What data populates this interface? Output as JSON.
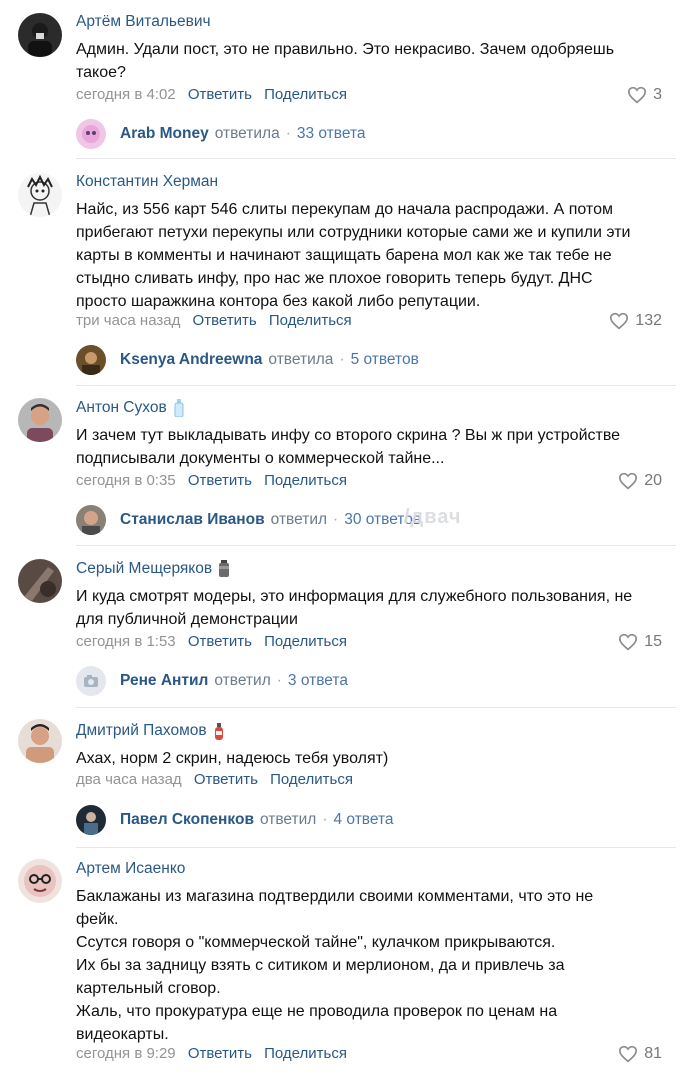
{
  "actions": {
    "reply": "Ответить",
    "share": "Поделиться"
  },
  "watermark": "/двач",
  "comments": [
    {
      "author": "Артём Витальевич",
      "text": "Админ. Удали пост, это не правильно. Это некрасиво. Зачем одобряешь\nтакое?",
      "time": "сегодня в 4:02",
      "likes": "3",
      "reply": {
        "name": "Arab Money",
        "verb": "ответила",
        "count": "33 ответа"
      }
    },
    {
      "author": "Константин Херман",
      "text": "Найс, из 556 карт 546 слиты перекупам до начала распродажи. А потом\nприбегают петухи перекупы или сотрудники которые сами же и купили эти\nкарты в комменты и начинают защищать барена мол как же так тебе не\nстыдно сливать инфу, про нас же плохое говорить теперь будут. ДНС\nпросто шаражкина контора без какой либо репутации.",
      "time": "три часа назад",
      "likes": "132",
      "reply": {
        "name": "Ksenya Andreewna",
        "verb": "ответила",
        "count": "5 ответов"
      }
    },
    {
      "author": "Антон Сухов",
      "text": "И зачем тут выкладывать инфу со второго скрина ? Вы ж при устройстве\nподписывали документы о коммерческой тайне...",
      "time": "сегодня в 0:35",
      "likes": "20",
      "reply": {
        "name": "Станислав Иванов",
        "verb": "ответил",
        "count": "30 ответов"
      }
    },
    {
      "author": "Серый Мещеряков",
      "text": "И куда смотрят модеры, это информация для служебного пользования, не\nдля публичной демонстрации",
      "time": "сегодня в 1:53",
      "likes": "15",
      "reply": {
        "name": "Рене Антил",
        "verb": "ответил",
        "count": "3 ответа"
      }
    },
    {
      "author": "Дмитрий Пахомов",
      "text": "Ахах, норм 2 скрин, надеюсь тебя уволят)",
      "time": "два часа назад",
      "likes": "",
      "reply": {
        "name": "Павел Скопенков",
        "verb": "ответил",
        "count": "4 ответа"
      }
    },
    {
      "author": "Артем Исаенко",
      "text": "Баклажаны из магазина подтвердили своими комментами, что это не\nфейк.\nСсутся говоря о \"коммерческой тайне\", кулачком прикрываются.\nИх бы за задницу взять с ситиком и мерлионом, да и привлечь за\nкартельный сговор.\nЖаль, что прокуратура еще не проводила проверок по ценам на\nвидеокарты.",
      "time": "сегодня в 9:29",
      "likes": "81"
    }
  ]
}
